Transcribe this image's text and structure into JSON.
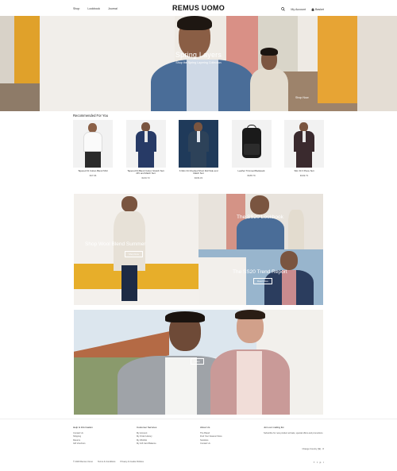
{
  "header": {
    "nav": [
      "Shop",
      "Lookbook",
      "Journal"
    ],
    "logo": "REMUS UOMO",
    "account": "My Account",
    "basket": "Basket"
  },
  "hero": {
    "title": "Spring Layers",
    "subtitle": "Shop the Spring Layering Collection",
    "caption": "Shop Now"
  },
  "recommended": {
    "title": "Recommended For You",
    "products": [
      {
        "name": "Tapered Fit Cotton-Blend Shirt",
        "price": "€47.96"
      },
      {
        "name": "Tapered Fit Blend Cotton Stretch Suit 2Pc and Match Suit",
        "price": "€219.73"
      },
      {
        "name": "X-Slim Fit Checked Short Roll Side and Match Suit",
        "price": "€239.33"
      },
      {
        "name": "Leather Trimmed Backpack",
        "price": "€188.79"
      },
      {
        "name": "Slim Fit 3 Piece Suit",
        "price": "€249.73"
      }
    ]
  },
  "promos": {
    "summer": "Shop Wool Blend Summer",
    "summer_btn": "Shop Now",
    "lookbook": "The SS20 Lookbook",
    "trend": "The SS20 Trend Report",
    "trend_btn": "Read More",
    "bottom_btn": "Shop"
  },
  "footer": {
    "col1": {
      "title": "Help & Information",
      "items": [
        "Contact Us",
        "Shipping",
        "Returns",
        "Gift Vouchers"
      ]
    },
    "col2": {
      "title": "Customer Services",
      "items": [
        "My Account",
        "My Order History",
        "My Wishlist",
        "My Gift Card Balance"
      ]
    },
    "col3": {
      "title": "About Us",
      "items": [
        "The Brand",
        "Find Your Nearest Store",
        "Stockists",
        "Contact Us"
      ]
    },
    "newsletter": {
      "title": "Join our mailing list",
      "note": "Subscribe for new product arrivals, special offers and promotions"
    },
    "currency": "Change Country (IE) · €",
    "legal": [
      "© 2020 Remus Uomo",
      "Terms & Conditions",
      "Privacy & Cookie Policies"
    ],
    "social": [
      "f",
      "t",
      "p",
      "i"
    ]
  },
  "colors": {
    "accent_yellow": "#e7ae2a",
    "suit_blue": "#4a6d98",
    "text": "#222222"
  }
}
